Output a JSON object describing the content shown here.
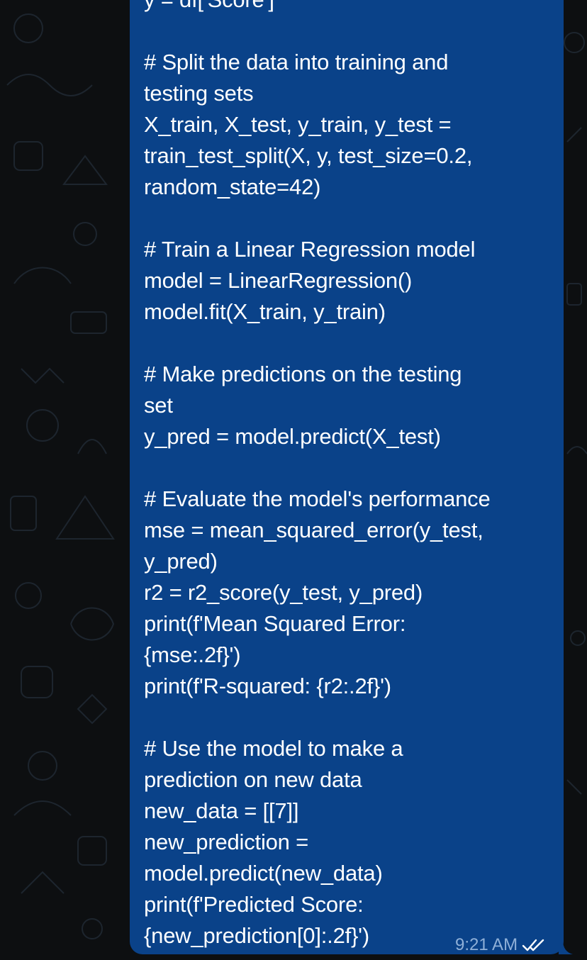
{
  "message": {
    "lines": [
      "y = df['Score']",
      "",
      "# Split the data into training and",
      "testing sets",
      "X_train, X_test, y_train, y_test =",
      "train_test_split(X, y, test_size=0.2,",
      "random_state=42)",
      "",
      "# Train a Linear Regression model",
      "model = LinearRegression()",
      "model.fit(X_train, y_train)",
      "",
      "# Make predictions on the testing",
      "set",
      "y_pred = model.predict(X_test)",
      "",
      "# Evaluate the model's performance",
      "mse = mean_squared_error(y_test,",
      "y_pred)",
      "r2 = r2_score(y_test, y_pred)",
      "print(f'Mean Squared Error:",
      "{mse:.2f}')",
      "print(f'R-squared: {r2:.2f}')",
      "",
      "# Use the model to make a",
      "prediction on new data",
      "new_data = [[7]]",
      "new_prediction =",
      "model.predict(new_data)",
      "print(f'Predicted Score:",
      "{new_prediction[0]:.2f}')"
    ],
    "time": "9:21 AM",
    "status_icon": "double-check-icon"
  },
  "colors": {
    "bubble": "#0a4289",
    "background": "#0d0f11",
    "text": "#ffffff",
    "meta": "#8fb0d8"
  }
}
